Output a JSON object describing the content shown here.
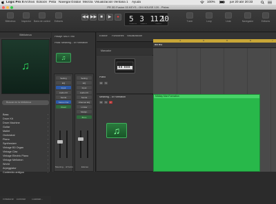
{
  "menubar": {
    "items": [
      "Logic Pro X",
      "Archivo",
      "Edición",
      "Pista",
      "Navegar",
      "Grabar",
      "Mezcla",
      "Visualización",
      "Ventana",
      "1",
      "Ayuda"
    ],
    "status": {
      "battery": "100%",
      "datetime": "jue 20 abr 20:33"
    }
  },
  "window": {
    "title": "PR 3D Fusion 03 KEYS - OH HOUSE 120 - Pistas"
  },
  "toolbar": {
    "left_tools": [
      "Biblioteca",
      "Inspector",
      "Barra de control",
      "Editores"
    ],
    "transport": [
      "◀◀",
      "▶▶",
      "■",
      "▶",
      "●"
    ],
    "lcd": {
      "position": "5 3 1 1",
      "tempo": "120",
      "beat": "1",
      "labels": [
        "COMPÁS",
        "TIEMPO",
        "TEMPO"
      ]
    },
    "right_tools": [
      "Tuner",
      "Loop",
      "Lista",
      "Navegador",
      "Editores"
    ]
  },
  "library": {
    "header": "Biblioteca",
    "search_placeholder": "Buscar en la biblioteca",
    "categories": [
      "Bass",
      "Drum Kit",
      "Drum Machine",
      "Guitar",
      "Mallet",
      "Orchestral",
      "Piano",
      "Synthesizer",
      "Vintage B3 Organ",
      "Vintage Clav",
      "Vintage Electric Piano",
      "Vintage Mellotron",
      "World",
      "Arpeggiator",
      "Contenido antiguo"
    ],
    "footer": {
      "revert": "Restaurar",
      "delete": "Eliminar",
      "save": "Guardar..."
    }
  },
  "inspector": {
    "region_label": "Pasaje: MIDI Thru",
    "track_label": "Pista: Meaning... of Formation",
    "strip1": {
      "slots": [
        "Setting",
        "EQ",
        "Input",
        "Audio FX",
        "Sends",
        "Stereo Out",
        "Read"
      ],
      "name": "Meaning... of Formation",
      "on": "ON"
    },
    "strip2": {
      "slots": [
        "Setting",
        "EQ",
        "Input",
        "Audio FX",
        "Sends",
        "Channel EQ",
        "Limiter",
        "Multipr.",
        "Bnce"
      ],
      "name": "Estéreo",
      "on": "Bnce"
    }
  },
  "tracks": {
    "menu": [
      "Edición",
      "Funciones",
      "Visualización"
    ],
    "marker_label": "INTRO",
    "ruler_bars": [
      "3",
      "4",
      "5",
      "6",
      "7"
    ],
    "global_label": "Marcador",
    "track1": {
      "name": "Piano"
    },
    "track2": {
      "name": "Meaning... of Formation"
    },
    "region": {
      "name": "Midday Man Formation"
    }
  }
}
